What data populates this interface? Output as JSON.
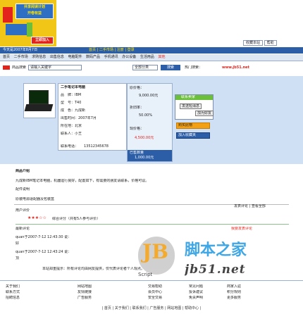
{
  "banner": {
    "line1": "共享阅读计划",
    "line2": "开卷有益",
    "button": "立即加入"
  },
  "toplinks": {
    "a": "收藏本站",
    "b": "帮助"
  },
  "nav_top": {
    "left": "今天是2007年8月7日",
    "center": "首页 | 二手市场 | 注册 | 登录"
  },
  "nav_items": [
    "首页",
    "二手市场",
    "求购信息",
    "出售信息",
    "电脑配件",
    "数码产品",
    "手机通讯",
    "办公设备",
    "生活用品",
    "其他"
  ],
  "search": {
    "label": "商品搜索",
    "value": "请输入关键字",
    "category": "全部分类",
    "button": "搜索",
    "hot_label": "热门搜索：",
    "hot_url": "www.jb51.net"
  },
  "product": {
    "title": "二手笔记本电脑",
    "rows": [
      "品　牌：IBM",
      "型　号：T40",
      "成　色：九成新",
      "出售时间：2007年7月",
      "所在地：北京",
      "联系人：小王"
    ],
    "phone_label": "联系电话：",
    "phone": "13512345678"
  },
  "prices": {
    "p1_label": "原价格：",
    "p1": "9,000.00元",
    "p2_label": "折旧率：",
    "p2": "50.00%",
    "p3_label": "现价格：",
    "p3": "4,500.00元",
    "p4_label": "已售数量",
    "p4": "1,000.00元"
  },
  "actions": {
    "box_title": "联系卖家",
    "b1": "发送短消息",
    "b2": "加为好友",
    "b3": "购买此物",
    "b4": "加入收藏夹"
  },
  "details": {
    "head": "商品介绍",
    "line1": "九成新IBM笔记本电脑，机器运行良好，配置如下，有需要的朋友请联系，价格可议。",
    "line2": "配件说明",
    "line3": "原装电源适配器及包装盒",
    "rating_label": "用户评价",
    "stars": "★★★☆☆",
    "rating_text": "综合评分（共有5人参与评价）",
    "right_links": "发表评论 | 查看全部",
    "section": "最新评论",
    "write_review": "我要发表评论",
    "c1_head": "quan于2007-7-12 12:43:30 说：",
    "c1_body": "好",
    "c2_head": "quan于2007-7-12 12:43:24 说：",
    "c2_body": "顶",
    "notice": "本站郑重提示：所有评论均由网友提供，仅代表评论者个人观点。"
  },
  "watermark": {
    "jb": "JB",
    "script": "Script",
    "cn": "脚本之家",
    "url": "jb51.net"
  },
  "footer": {
    "col1": [
      "关于我们",
      "联系方式",
      "招聘信息"
    ],
    "col2": [
      "网站地图",
      "友情链接",
      "广告服务"
    ],
    "col3": [
      "交易帮助",
      "会员中心",
      "安全交易"
    ],
    "col4": [
      "常见问题",
      "投诉建议",
      "免责声明"
    ],
    "col5": [
      "商家入驻",
      "积分规则",
      "更多服务"
    ],
    "bar": "| 首页 | 关于我们 | 联系我们 | 广告服务 | 网站地图 | 帮助中心 |"
  }
}
